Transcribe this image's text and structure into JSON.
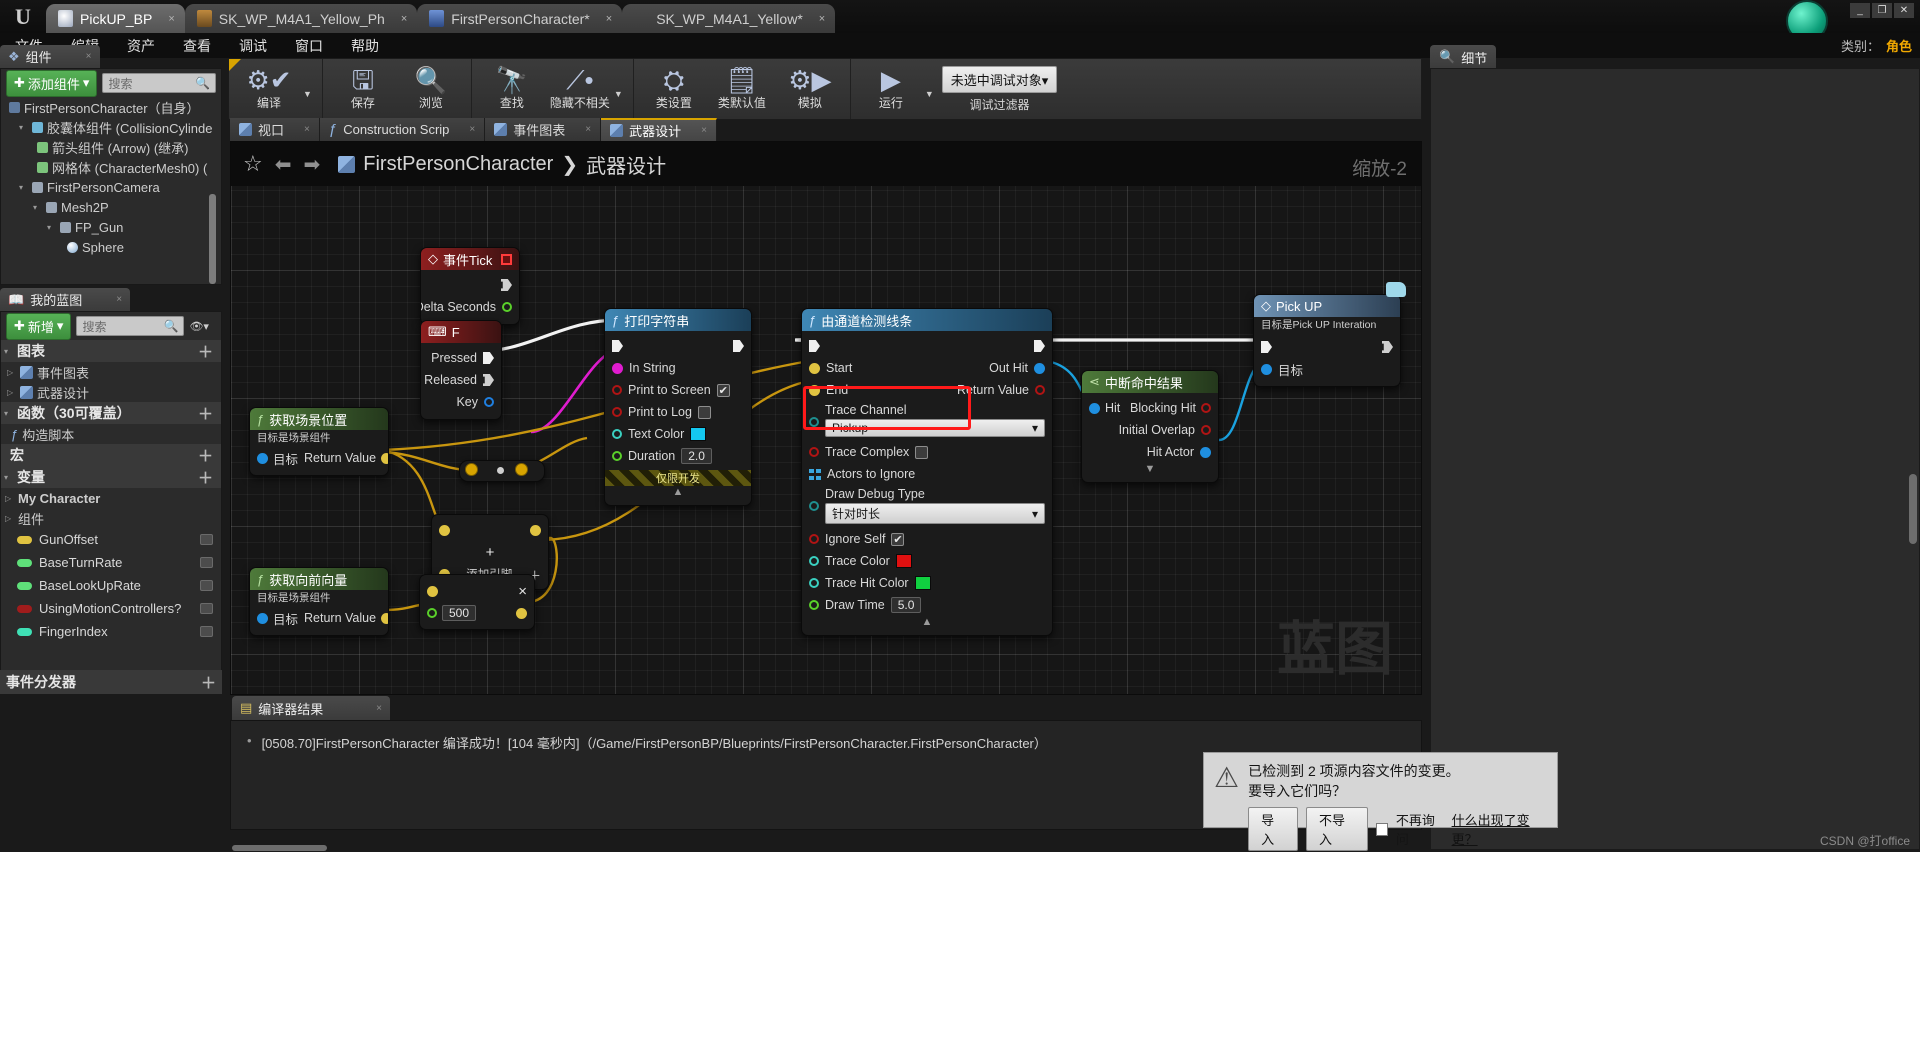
{
  "window": {
    "tabs": [
      {
        "label": "PickUP_BP",
        "state": "active",
        "icon_color": "#cfd6e8",
        "close": "×"
      },
      {
        "label": "SK_WP_M4A1_Yellow_Ph",
        "state": "inactive",
        "icon_color": "#c08a3e",
        "close": "×"
      },
      {
        "label": "FirstPersonCharacter*",
        "state": "inactive",
        "icon_color": "#4a72c4",
        "close": "×"
      },
      {
        "label": "SK_WP_M4A1_Yellow*",
        "state": "inactive",
        "icon_color": "#d618b6",
        "close": "×"
      }
    ],
    "controls": [
      "_",
      "❐",
      "✕"
    ]
  },
  "menubar": {
    "items": [
      "文件",
      "编辑",
      "资产",
      "查看",
      "调试",
      "窗口",
      "帮助"
    ],
    "category_label": "类别：",
    "category_value": "角色"
  },
  "toolbar": {
    "groups": [
      {
        "items": [
          {
            "label": "编译",
            "icon": "compile-icon",
            "glyph": "⚙",
            "dropdown": true
          }
        ]
      },
      {
        "items": [
          {
            "label": "保存",
            "icon": "save-icon",
            "glyph": "💾"
          },
          {
            "label": "浏览",
            "icon": "browse-icon",
            "glyph": "🔍"
          }
        ]
      },
      {
        "items": [
          {
            "label": "查找",
            "icon": "find-icon",
            "glyph": "🔭"
          },
          {
            "label": "隐藏不相关",
            "icon": "hide-unrelated-icon",
            "glyph": "⌥",
            "dropdown": true
          }
        ]
      },
      {
        "items": [
          {
            "label": "类设置",
            "icon": "class-settings-icon",
            "glyph": "⚙"
          },
          {
            "label": "类默认值",
            "icon": "class-defaults-icon",
            "glyph": "☑"
          },
          {
            "label": "模拟",
            "icon": "simulate-icon",
            "glyph": "⚙"
          }
        ]
      },
      {
        "items": [
          {
            "label": "运行",
            "icon": "play-icon",
            "glyph": "▶",
            "dropdown": true
          }
        ]
      }
    ],
    "debug_combo": "未选中调试对象",
    "debug_filter_label": "调试过滤器"
  },
  "components_panel": {
    "tab_label": "组件",
    "tab_icon": "components-icon",
    "add_button": "添加组件",
    "search_placeholder": "搜索",
    "tree": [
      {
        "label": "FirstPersonCharacter（自身）",
        "indent": 0,
        "icon": "#5f7a9e",
        "arrow": ""
      },
      {
        "label": "胶囊体组件 (CollisionCylinde",
        "indent": 1,
        "icon": "#6fb7d8",
        "arrow": "▾"
      },
      {
        "label": "箭头组件 (Arrow) (继承)",
        "indent": 2,
        "icon": "#7cc47c",
        "arrow": ""
      },
      {
        "label": "网格体 (CharacterMesh0) (",
        "indent": 2,
        "icon": "#7cc47c",
        "arrow": ""
      },
      {
        "label": "FirstPersonCamera",
        "indent": 1,
        "icon": "#9aa6b5",
        "arrow": "▾"
      },
      {
        "label": "Mesh2P",
        "indent": 2,
        "icon": "#9aa6b5",
        "arrow": "▾"
      },
      {
        "label": "FP_Gun",
        "indent": 3,
        "icon": "#9aa6b5",
        "arrow": "▾"
      },
      {
        "label": "Sphere",
        "indent": 4,
        "icon": "#9ec8ea",
        "arrow": ""
      }
    ]
  },
  "myblueprint_panel": {
    "tab_label": "我的蓝图",
    "tab_icon": "book-icon",
    "add_button": "新增",
    "search_placeholder": "搜索",
    "sections": [
      {
        "title": "图表",
        "items": [
          {
            "label": "事件图表",
            "icon": "graph-icon"
          },
          {
            "label": "武器设计",
            "icon": "graph-icon"
          }
        ]
      },
      {
        "title": "函数（30可覆盖）",
        "items": [
          {
            "label": "构造脚本",
            "icon": "function-icon"
          }
        ]
      },
      {
        "title": "宏",
        "items": []
      },
      {
        "title": "变量",
        "items": []
      }
    ],
    "variable_groups": [
      {
        "label": "My Character",
        "arrow": "▷"
      },
      {
        "label": "组件",
        "arrow": "▷"
      }
    ],
    "variables": [
      {
        "name": "GunOffset",
        "color": "#e0c341"
      },
      {
        "name": "BaseTurnRate",
        "color": "#5fe07a"
      },
      {
        "name": "BaseLookUpRate",
        "color": "#5fe07a"
      },
      {
        "name": "UsingMotionControllers?",
        "color": "#a01c1c"
      },
      {
        "name": "FingerIndex",
        "color": "#3fe0b5"
      }
    ],
    "event_dispatcher_label": "事件分发器"
  },
  "graph_tabs": [
    {
      "label": "视口",
      "selected": false,
      "icon": "viewport-icon"
    },
    {
      "label": "Construction Scrip",
      "selected": false,
      "icon": "function-icon"
    },
    {
      "label": "事件图表",
      "selected": false,
      "icon": "graph-icon"
    },
    {
      "label": "武器设计",
      "selected": true,
      "icon": "graph-icon"
    }
  ],
  "graph_header": {
    "breadcrumb_root": "FirstPersonCharacter",
    "breadcrumb_sep": "❯",
    "breadcrumb_leaf": "武器设计",
    "zoom_label": "缩放-2",
    "watermark": "蓝图"
  },
  "nodes": {
    "event_tick": {
      "title": "事件Tick",
      "pins": [
        {
          "label": "Delta Seconds",
          "type": "float"
        }
      ]
    },
    "key_f": {
      "title": "F",
      "pins": [
        {
          "label": "Pressed"
        },
        {
          "label": "Released"
        },
        {
          "label": "Key"
        }
      ]
    },
    "get_actor_location": {
      "title": "获取场景位置",
      "subtitle": "目标是场景组件",
      "in": "目标",
      "out": "Return Value"
    },
    "get_forward_vector": {
      "title": "获取向前向量",
      "subtitle": "目标是场景组件",
      "in": "目标",
      "out": "Return Value"
    },
    "multiply": {
      "value": "500",
      "op": "×"
    },
    "add": {
      "op": "+",
      "label": "添加引脚"
    },
    "print_string": {
      "title": "打印字符串",
      "in_string": "In String",
      "print_to_screen": "Print to Screen",
      "print_to_screen_checked": true,
      "print_to_log": "Print to Log",
      "print_to_log_checked": false,
      "text_color": "Text Color",
      "text_color_value": "#14c8f0",
      "duration": "Duration",
      "duration_value": "2.0",
      "dev_only": "仅限开发"
    },
    "line_trace": {
      "title": "由通道检测线条",
      "start": "Start",
      "end": "End",
      "trace_channel_label": "Trace Channel",
      "trace_channel_value": "Pickup",
      "trace_complex": "Trace Complex",
      "trace_complex_checked": false,
      "actors_to_ignore": "Actors to Ignore",
      "draw_debug_label": "Draw Debug Type",
      "draw_debug_value": "针对时长",
      "ignore_self": "Ignore Self",
      "ignore_self_checked": true,
      "trace_color": "Trace Color",
      "trace_color_value": "#e01010",
      "trace_hit_color": "Trace Hit Color",
      "trace_hit_color_value": "#10d040",
      "draw_time": "Draw Time",
      "draw_time_value": "5.0",
      "out_hit": "Out Hit",
      "return_value": "Return Value"
    },
    "break_hit_result": {
      "title": "中断命中结果",
      "in": "Hit",
      "outs": [
        "Blocking Hit",
        "Initial Overlap",
        "Hit Actor"
      ]
    },
    "pick_up": {
      "title": "Pick UP",
      "subtitle": "目标是Pick UP Interation",
      "target": "目标"
    }
  },
  "compiler_results": {
    "tab_label": "编译器结果",
    "tab_icon": "results-icon",
    "message": "[0508.70]FirstPersonCharacter 编译成功！[104 毫秒内]（/Game/FirstPersonBP/Blueprints/FirstPersonCharacter.FirstPersonCharacter）"
  },
  "details_panel": {
    "tab_label": "细节",
    "tab_icon": "search-icon"
  },
  "notification": {
    "icon": "warning-icon",
    "line1": "已检测到 2 项源内容文件的变更。",
    "line2": "要导入它们吗？",
    "import_button": "导入",
    "dont_import_button": "不导入",
    "dont_ask_label": "不再询问",
    "whats_changed_link": "什么出现了变更？"
  },
  "watermark_credit": "CSDN @打office"
}
